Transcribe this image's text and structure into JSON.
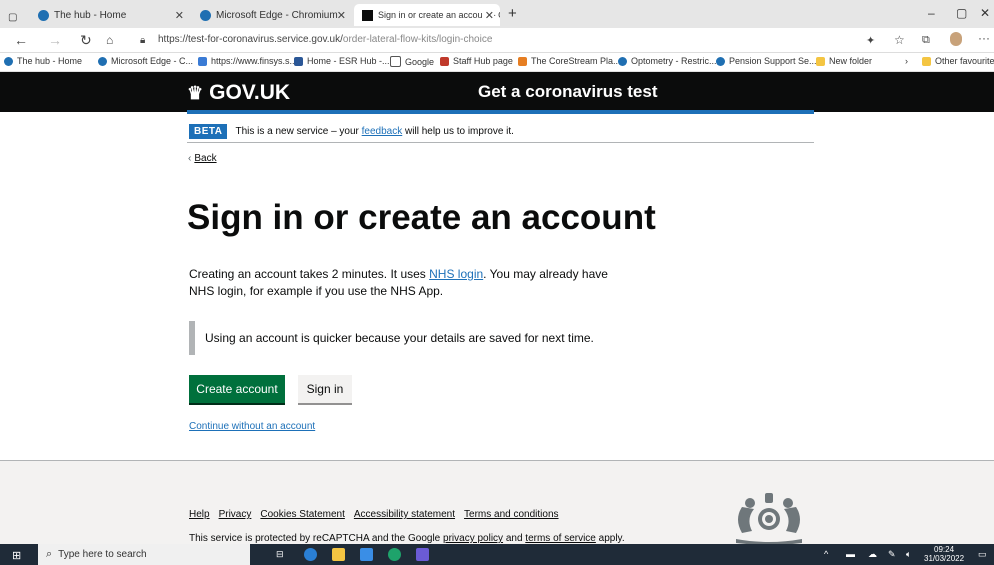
{
  "browser": {
    "tabs": [
      {
        "title": "The hub - Home",
        "active": false
      },
      {
        "title": "Microsoft Edge - Chromium",
        "active": false
      },
      {
        "title": "Sign in or create an account - G",
        "active": true
      }
    ],
    "new_tab": "+",
    "window_controls": {
      "minimize": "–",
      "restore": "▢",
      "close": "✕"
    },
    "url_main": "https://test-for-coronavirus.service.gov.uk/",
    "url_path": "order-lateral-flow-kits/login-choice",
    "bookmarks": [
      {
        "label": "The hub - Home",
        "color": "#1f6fb2"
      },
      {
        "label": "Microsoft Edge - C...",
        "color": "#1f6fb2"
      },
      {
        "label": "https://www.finsys.s...",
        "color": "#3a7bd5"
      },
      {
        "label": "Home - ESR Hub -...",
        "color": "#2b5797"
      },
      {
        "label": "Google",
        "color": "#555555"
      },
      {
        "label": "Staff Hub page",
        "color": "#c0392b"
      },
      {
        "label": "The CoreStream Pla...",
        "color": "#e67e22"
      },
      {
        "label": "Optometry - Restric...",
        "color": "#1f6fb2"
      },
      {
        "label": "Pension Support Se...",
        "color": "#1f6fb2"
      },
      {
        "label": "New folder",
        "color": "#f4c542"
      }
    ],
    "other_favourites": "Other favourite"
  },
  "header": {
    "logo_text": "GOV.UK",
    "service_name": "Get a coronavirus test"
  },
  "phase_banner": {
    "tag": "BETA",
    "text_before": "This is a new service – your ",
    "link": "feedback",
    "text_after": " will help us to improve it."
  },
  "back_link": "Back",
  "main": {
    "heading": "Sign in or create an account",
    "para_before": "Creating an account takes 2 minutes. It uses ",
    "para_link": "NHS login",
    "para_after": ". You may already have NHS login, for example if you use the NHS App.",
    "inset": "Using an account is quicker because your details are saved for next time.",
    "create_button": "Create account",
    "signin_button": "Sign in",
    "continue_link": "Continue without an account"
  },
  "footer": {
    "links": [
      "Help",
      "Privacy",
      "Cookies Statement",
      "Accessibility statement",
      "Terms and conditions"
    ],
    "recaptcha_before": "This service is protected by reCAPTCHA and the Google ",
    "recaptcha_privacy": "privacy policy",
    "recaptcha_mid": " and ",
    "recaptcha_terms": "terms of service",
    "recaptcha_after": " apply."
  },
  "taskbar": {
    "search_placeholder": "Type here to search",
    "time": "09:24",
    "date": "31/03/2022"
  }
}
